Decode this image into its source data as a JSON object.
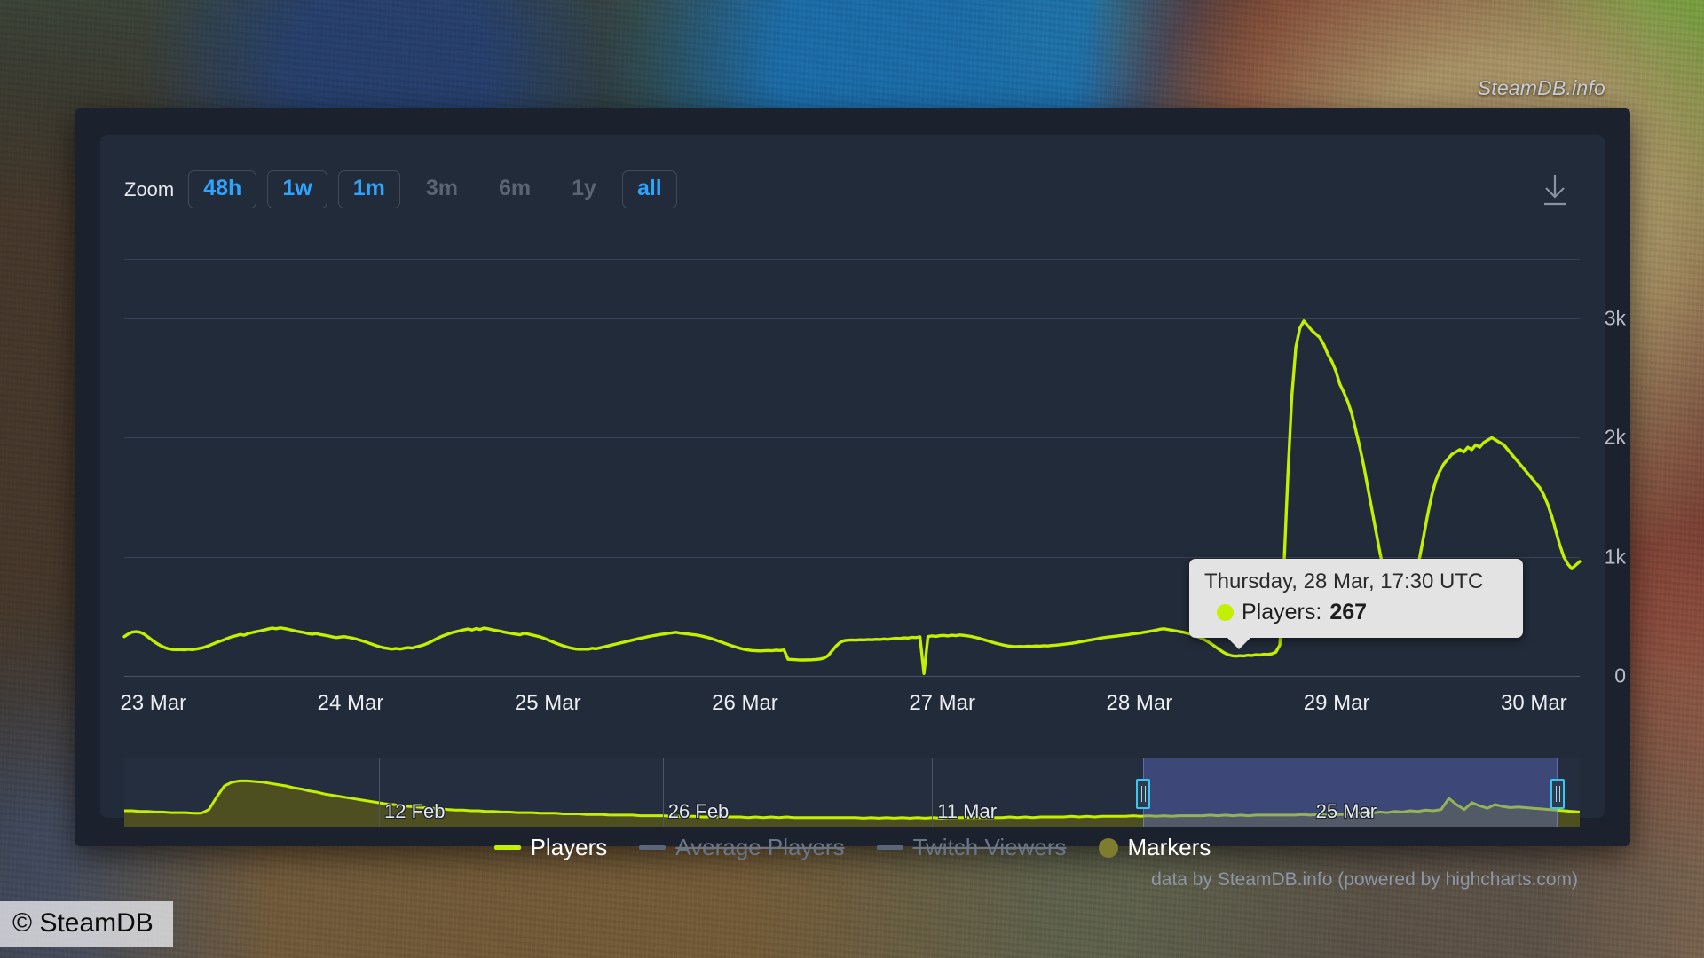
{
  "brand": "SteamDB.info",
  "watermark": "© SteamDB",
  "credit": "data by SteamDB.info (powered by highcharts.com)",
  "range_selector": {
    "label": "Zoom",
    "buttons": [
      {
        "label": "48h",
        "state": "on"
      },
      {
        "label": "1w",
        "state": "on"
      },
      {
        "label": "1m",
        "state": "on"
      },
      {
        "label": "3m",
        "state": "off"
      },
      {
        "label": "6m",
        "state": "off"
      },
      {
        "label": "1y",
        "state": "off"
      },
      {
        "label": "all",
        "state": "on"
      }
    ]
  },
  "toolbar": {
    "download_icon": "download-icon"
  },
  "tooltip": {
    "header": "Thursday, 28 Mar, 17:30 UTC",
    "series_label": "Players:",
    "value": "267",
    "dot_color": "#c3f000"
  },
  "legend": [
    {
      "label": "Players",
      "marker": "line",
      "state": "on",
      "color": "#c3f000"
    },
    {
      "label": "Average Players",
      "marker": "line",
      "state": "off",
      "color": "#5b6679"
    },
    {
      "label": "Twitch Viewers",
      "marker": "line",
      "state": "off",
      "color": "#5b6679"
    },
    {
      "label": "Markers",
      "marker": "circle",
      "state": "on",
      "color": "#7e7c2f"
    }
  ],
  "navigator": {
    "labels": [
      "12 Feb",
      "26 Feb",
      "11 Mar",
      "25 Mar"
    ],
    "label_positions": [
      0.175,
      0.37,
      0.555,
      0.815
    ],
    "divider_positions": [
      0.175,
      0.37,
      0.555
    ],
    "selection": {
      "start": 0.7,
      "end": 0.985
    },
    "series_color": "#c3f000",
    "fill_color": "#4e4f20",
    "values": [
      0.2,
      0.2,
      0.19,
      0.19,
      0.18,
      0.18,
      0.17,
      0.17,
      0.17,
      0.16,
      0.16,
      0.22,
      0.42,
      0.6,
      0.66,
      0.68,
      0.68,
      0.67,
      0.66,
      0.64,
      0.62,
      0.6,
      0.57,
      0.55,
      0.52,
      0.5,
      0.47,
      0.45,
      0.43,
      0.41,
      0.39,
      0.37,
      0.35,
      0.33,
      0.31,
      0.3,
      0.28,
      0.27,
      0.26,
      0.25,
      0.24,
      0.23,
      0.22,
      0.21,
      0.21,
      0.2,
      0.2,
      0.19,
      0.19,
      0.18,
      0.18,
      0.17,
      0.17,
      0.17,
      0.16,
      0.16,
      0.16,
      0.15,
      0.15,
      0.15,
      0.14,
      0.14,
      0.14,
      0.13,
      0.13,
      0.13,
      0.13,
      0.12,
      0.12,
      0.12,
      0.12,
      0.11,
      0.11,
      0.11,
      0.11,
      0.1,
      0.1,
      0.1,
      0.1,
      0.1,
      0.1,
      0.09,
      0.1,
      0.09,
      0.1,
      0.09,
      0.1,
      0.09,
      0.09,
      0.09,
      0.09,
      0.09,
      0.09,
      0.09,
      0.09,
      0.09,
      0.08,
      0.09,
      0.08,
      0.09,
      0.08,
      0.09,
      0.08,
      0.09,
      0.08,
      0.09,
      0.08,
      0.09,
      0.09,
      0.09,
      0.09,
      0.09,
      0.09,
      0.09,
      0.09,
      0.1,
      0.09,
      0.1,
      0.09,
      0.1,
      0.1,
      0.1,
      0.1,
      0.11,
      0.1,
      0.11,
      0.1,
      0.11,
      0.11,
      0.11,
      0.11,
      0.12,
      0.11,
      0.12,
      0.11,
      0.12,
      0.11,
      0.12,
      0.12,
      0.12,
      0.12,
      0.13,
      0.12,
      0.13,
      0.12,
      0.13,
      0.12,
      0.13,
      0.13,
      0.13,
      0.13,
      0.13,
      0.13,
      0.14,
      0.13,
      0.14,
      0.13,
      0.14,
      0.14,
      0.15,
      0.16,
      0.17,
      0.16,
      0.18,
      0.17,
      0.19,
      0.18,
      0.2,
      0.19,
      0.21,
      0.2,
      0.22,
      0.4,
      0.3,
      0.22,
      0.33,
      0.28,
      0.24,
      0.3,
      0.27,
      0.25,
      0.26,
      0.25,
      0.24,
      0.23,
      0.22,
      0.21,
      0.2,
      0.19,
      0.18
    ]
  },
  "chart_data": {
    "type": "line",
    "title": "",
    "xlabel": "",
    "ylabel": "",
    "grid": true,
    "legend_position": "bottom",
    "ylim": [
      0,
      3500
    ],
    "yticks": [
      0,
      1000,
      2000,
      3000
    ],
    "ytick_labels": [
      "0",
      "1k",
      "2k",
      "3k"
    ],
    "xticks": [
      "23 Mar",
      "24 Mar",
      "25 Mar",
      "26 Mar",
      "27 Mar",
      "28 Mar",
      "29 Mar",
      "30 Mar"
    ],
    "xtick_positions": [
      0.02,
      0.1555,
      0.291,
      0.4265,
      0.562,
      0.6975,
      0.833,
      0.9685
    ],
    "series": [
      {
        "name": "Players",
        "color": "#c3f000",
        "values": [
          330,
          352,
          368,
          372,
          366,
          350,
          326,
          300,
          276,
          256,
          240,
          228,
          222,
          220,
          222,
          219,
          224,
          221,
          226,
          232,
          240,
          252,
          266,
          280,
          292,
          304,
          318,
          330,
          338,
          348,
          342,
          356,
          364,
          372,
          378,
          386,
          394,
          402,
          396,
          404,
          398,
          392,
          384,
          376,
          370,
          364,
          356,
          350,
          356,
          348,
          342,
          336,
          328,
          322,
          326,
          330,
          324,
          318,
          310,
          300,
          290,
          278,
          266,
          254,
          244,
          236,
          230,
          226,
          230,
          226,
          232,
          238,
          234,
          244,
          252,
          262,
          276,
          292,
          310,
          326,
          340,
          352,
          364,
          372,
          380,
          388,
          394,
          386,
          398,
          390,
          402,
          396,
          388,
          382,
          376,
          368,
          362,
          356,
          350,
          346,
          358,
          352,
          344,
          336,
          328,
          316,
          302,
          288,
          274,
          262,
          250,
          240,
          232,
          226,
          224,
          226,
          224,
          232,
          228,
          236,
          244,
          252,
          260,
          268,
          276,
          284,
          292,
          300,
          308,
          316,
          322,
          330,
          336,
          342,
          348,
          352,
          358,
          362,
          366,
          360,
          356,
          352,
          348,
          344,
          338,
          330,
          322,
          312,
          300,
          288,
          276,
          264,
          252,
          242,
          232,
          224,
          218,
          214,
          212,
          210,
          212,
          214,
          212,
          216,
          214,
          218,
          140,
          138,
          136,
          134,
          134,
          135,
          136,
          138,
          142,
          150,
          170,
          210,
          250,
          280,
          296,
          300,
          302,
          300,
          304,
          302,
          306,
          304,
          308,
          306,
          310,
          308,
          312,
          316,
          314,
          320,
          318,
          324,
          322,
          328,
          20,
          330,
          336,
          332,
          338,
          340,
          336,
          342,
          338,
          344,
          340,
          336,
          330,
          322,
          314,
          304,
          294,
          284,
          274,
          266,
          258,
          252,
          248,
          246,
          248,
          246,
          250,
          248,
          252,
          250,
          254,
          252,
          256,
          258,
          262,
          266,
          270,
          274,
          280,
          286,
          292,
          298,
          304,
          310,
          316,
          322,
          326,
          330,
          334,
          338,
          342,
          346,
          352,
          356,
          360,
          366,
          372,
          378,
          384,
          392,
          396,
          390,
          384,
          378,
          372,
          366,
          358,
          348,
          336,
          322,
          306,
          288,
          266,
          242,
          218,
          196,
          180,
          170,
          166,
          170,
          168,
          174,
          172,
          178,
          176,
          182,
          180,
          186,
          200,
          260,
          900,
          1680,
          2350,
          2760,
          2920,
          2980,
          2940,
          2900,
          2870,
          2840,
          2780,
          2700,
          2640,
          2560,
          2450,
          2380,
          2300,
          2200,
          2060,
          1920,
          1760,
          1580,
          1400,
          1220,
          1040,
          880,
          760,
          680,
          630,
          612,
          620,
          660,
          740,
          860,
          1000,
          1180,
          1360,
          1520,
          1640,
          1720,
          1780,
          1820,
          1860,
          1880,
          1900,
          1880,
          1920,
          1900,
          1940,
          1920,
          1960,
          1980,
          2000,
          1980,
          1960,
          1940,
          1900,
          1860,
          1820,
          1780,
          1740,
          1700,
          1660,
          1620,
          1580,
          1520,
          1440,
          1340,
          1220,
          1100,
          1000,
          940,
          900,
          930,
          960
        ]
      }
    ],
    "annotation": {
      "point_label": "Thursday, 28 Mar, 17:30 UTC",
      "point_series": "Players",
      "point_value": 267
    }
  }
}
